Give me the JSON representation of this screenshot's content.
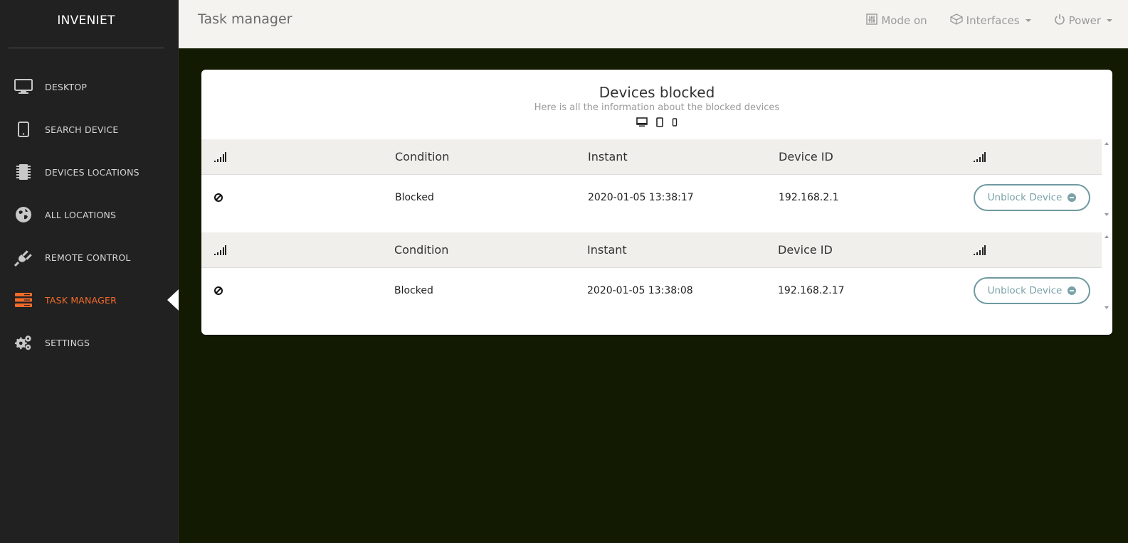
{
  "brand": "INVENIET",
  "nav": [
    {
      "label": "DESKTOP",
      "icon": "desktop-icon"
    },
    {
      "label": "SEARCH DEVICE",
      "icon": "tablet-icon"
    },
    {
      "label": "DEVICES LOCATIONS",
      "icon": "chip-icon"
    },
    {
      "label": "ALL LOCATIONS",
      "icon": "globe-icon"
    },
    {
      "label": "REMOTE CONTROL",
      "icon": "plug-icon"
    },
    {
      "label": "TASK MANAGER",
      "icon": "server-icon",
      "active": true
    },
    {
      "label": "SETTINGS",
      "icon": "gears-icon"
    }
  ],
  "topbar": {
    "title": "Task manager",
    "mode": "Mode on",
    "interfaces": "Interfaces",
    "power": "Power"
  },
  "card": {
    "title": "Devices blocked",
    "subtitle": "Here is all the information about the blocked devices"
  },
  "tables": [
    {
      "headers": [
        "Condition",
        "Instant",
        "Device ID"
      ],
      "row": {
        "condition": "Blocked",
        "instant": "2020-01-05 13:38:17",
        "device_id": "192.168.2.1",
        "action": "Unblock Device"
      }
    },
    {
      "headers": [
        "Condition",
        "Instant",
        "Device ID"
      ],
      "row": {
        "condition": "Blocked",
        "instant": "2020-01-05 13:38:08",
        "device_id": "192.168.2.17",
        "action": "Unblock Device"
      }
    }
  ],
  "colors": {
    "sidebar": "#212121",
    "accent": "#f26b2a",
    "button": "#7aa2a8",
    "background": "#121a02"
  }
}
